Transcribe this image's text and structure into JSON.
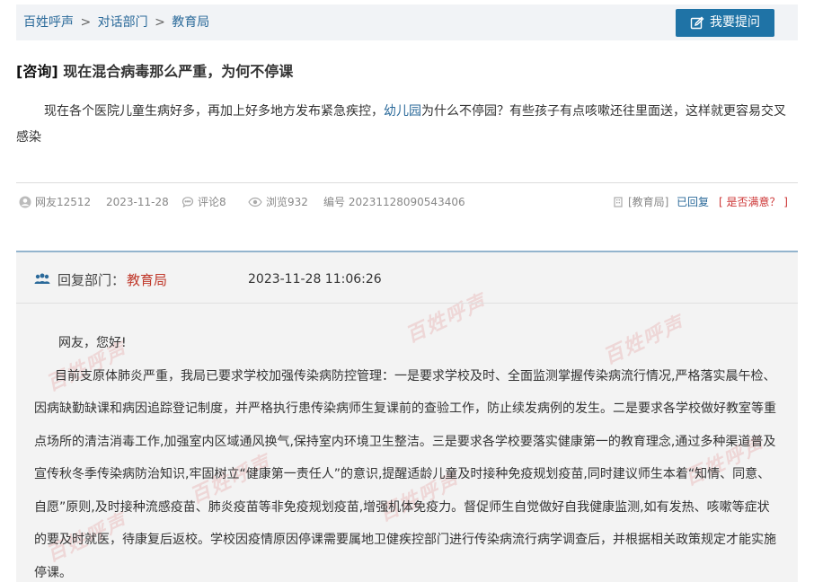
{
  "breadcrumb": {
    "home": "百姓呼声",
    "sep1": ">",
    "section": "对话部门",
    "sep2": ">",
    "current": "教育局"
  },
  "ask_button": {
    "label": "我要提问",
    "icon": "edit-icon"
  },
  "post": {
    "tag": "[咨询]",
    "title": "现在混合病毒那么严重，为何不停课",
    "question_before": "现在各个医院儿童生病好多，再加上好多地方发布紧急疾控，",
    "question_link": "幼儿园",
    "question_after": "为什么不停园？有些孩子有点咳嗽还往里面送，这样就更容易交叉感染"
  },
  "meta": {
    "user": "网友12512",
    "date": "2023-11-28",
    "comments": "评论8",
    "views": "浏览932",
    "serial": "编号 20231128090543406",
    "dept": "[教育局]",
    "status": "已回复",
    "satisfied": "[ 是否满意？ ]"
  },
  "reply": {
    "label": "回复部门：",
    "dept": "教育局",
    "time": "2023-11-28 11:06:26",
    "greeting": "网友，您好!",
    "body": "目前支原体肺炎严重，我局已要求学校加强传染病防控管理：一是要求学校及时、全面监测掌握传染病流行情况,严格落实晨午检、因病缺勤缺课和病因追踪登记制度，并严格执行患传染病师生复课前的查验工作，防止续发病例的发生。二是要求各学校做好教室等重点场所的清洁消毒工作,加强室内区域通风换气,保持室内环境卫生整洁。三是要求各学校要落实健康第一的教育理念,通过多种渠道普及宣传秋冬季传染病防治知识,牢固树立“健康第一责任人”的意识,提醒适龄儿童及时接种免疫规划疫苗,同时建议师生本着“知情、同意、自愿”原则,及时接种流感疫苗、肺炎疫苗等非免疫规划疫苗,增强机体免疫力。督促师生自觉做好自我健康监测,如有发热、咳嗽等症状的要及时就医，待康复后返校。学校因疫情原因停课需要属地卫健疾控部门进行传染病流行病学调查后，并根据相关政策规定才能实施停课。"
  },
  "watermark": "百姓呼声",
  "colors": {
    "accent": "#1f73a6",
    "link": "#2b6a9a",
    "alert": "#c0392b"
  }
}
